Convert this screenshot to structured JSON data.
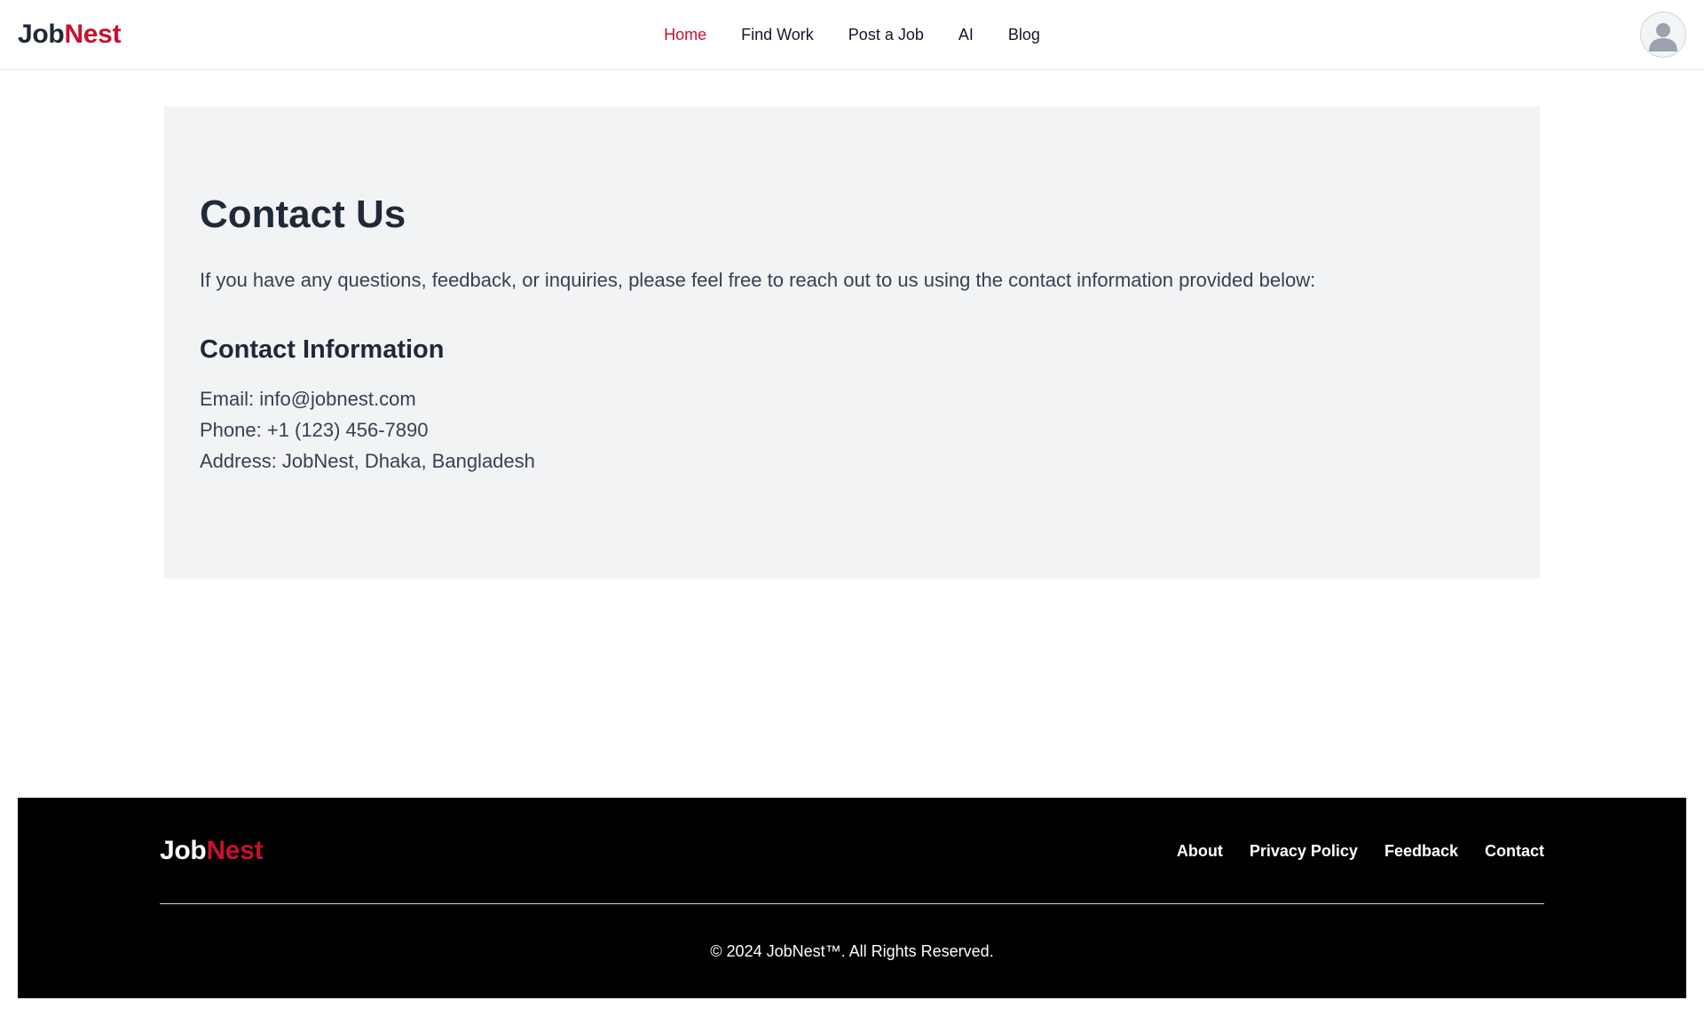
{
  "header": {
    "brand_part1": "Job",
    "brand_part2": "Nest",
    "nav": [
      {
        "label": "Home",
        "active": true
      },
      {
        "label": "Find Work",
        "active": false
      },
      {
        "label": "Post a Job",
        "active": false
      },
      {
        "label": "AI",
        "active": false
      },
      {
        "label": "Blog",
        "active": false
      }
    ],
    "avatar_icon": "user-avatar-icon"
  },
  "main": {
    "title": "Contact Us",
    "intro": "If you have any questions, feedback, or inquiries, please feel free to reach out to us using the contact information provided below:",
    "section_title": "Contact Information",
    "email_line": "Email: info@jobnest.com",
    "phone_line": "Phone: +1 (123) 456-7890",
    "address_line": "Address: JobNest, Dhaka, Bangladesh"
  },
  "footer": {
    "brand_part1": "Job",
    "brand_part2": "Nest",
    "links": [
      "About",
      "Privacy Policy",
      "Feedback",
      "Contact"
    ],
    "copyright": "© 2024 JobNest™. All Rights Reserved."
  },
  "colors": {
    "accent": "#c8102e",
    "text_dark": "#1f2937",
    "card_bg": "#f2f3f5",
    "footer_bg": "#000000"
  }
}
